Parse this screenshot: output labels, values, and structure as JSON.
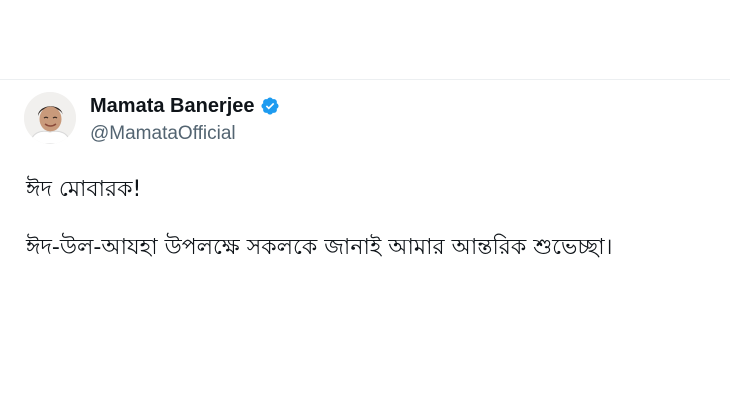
{
  "tweet": {
    "author": {
      "display_name": "Mamata Banerjee",
      "handle": "@MamataOfficial",
      "verified": true,
      "avatar_icon": "user-avatar",
      "verified_icon": "verified-badge-icon"
    },
    "text": {
      "line1": "ঈদ মোবারক!",
      "line2": "ঈদ-উল-আযহা উপলক্ষে সকলকে জানাই আমার আন্তরিক শুভেচ্ছা।"
    }
  },
  "colors": {
    "name": "#0f1419",
    "handle": "#536471",
    "verified": "#1d9bf0",
    "divider": "#eceff1"
  }
}
